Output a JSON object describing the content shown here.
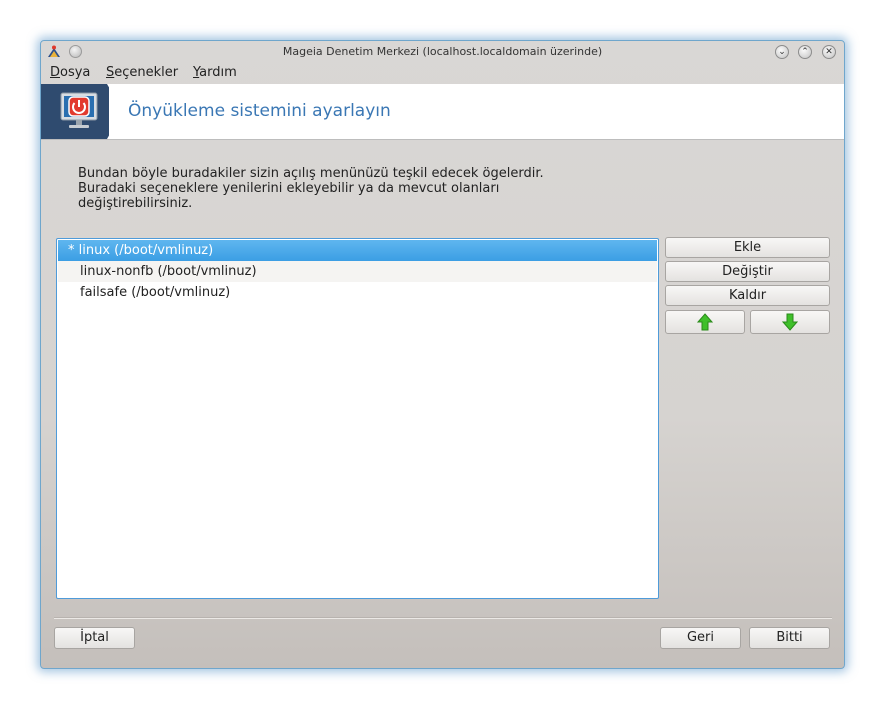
{
  "window": {
    "title": "Mageia Denetim Merkezi  (localhost.localdomain üzerinde)"
  },
  "menu": {
    "items": [
      {
        "mnemonic": "D",
        "rest": "osya"
      },
      {
        "mnemonic": "S",
        "rest": "eçenekler"
      },
      {
        "mnemonic": "Y",
        "rest": "ardım"
      }
    ]
  },
  "banner": {
    "title": "Önyükleme sistemini ayarlayın",
    "icon": "power-monitor-icon",
    "icon_bg_color": "#2f4b6f",
    "title_color": "#3a77b4"
  },
  "description": {
    "lines": [
      "Bundan böyle buradakiler sizin açılış menünüzü teşkil edecek ögelerdir.",
      "Buradaki seçeneklere yenilerini ekleyebilir ya da mevcut olanları",
      "değiştirebilirsiniz."
    ]
  },
  "entries": [
    {
      "text": "*  linux (/boot/vmlinuz)",
      "selected": true
    },
    {
      "text": "linux-nonfb (/boot/vmlinuz)",
      "selected": false
    },
    {
      "text": "failsafe (/boot/vmlinuz)",
      "selected": false
    }
  ],
  "side_buttons": {
    "add": "Ekle",
    "modify": "Değiştir",
    "remove": "Kaldır",
    "up_icon": "arrow-up-icon",
    "down_icon": "arrow-down-icon"
  },
  "footer": {
    "cancel": "İptal",
    "back": "Geri",
    "finish": "Bitti"
  },
  "colors": {
    "selection": "#3b9ee4",
    "accent_border": "#4f9bd9",
    "arrow_green": "#3fbf2a"
  }
}
